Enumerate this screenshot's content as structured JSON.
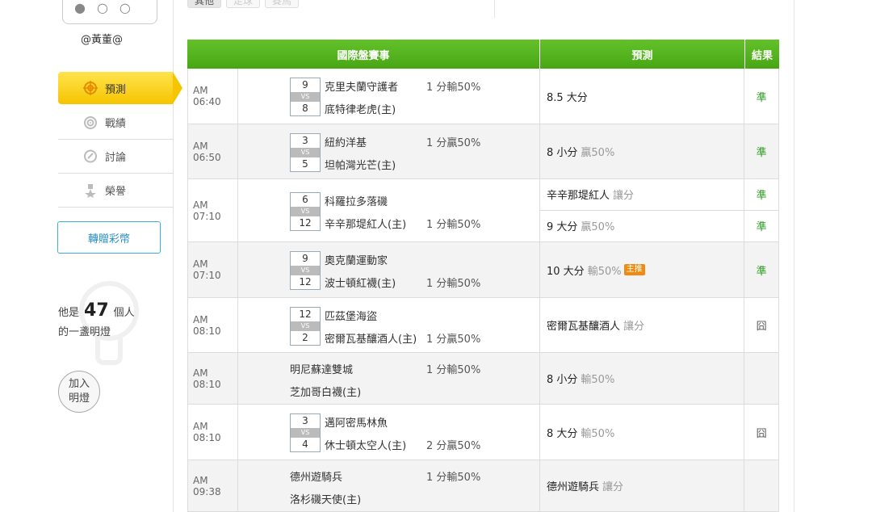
{
  "user": {
    "name": "@黃董@"
  },
  "menu": [
    {
      "label": "預測",
      "icon": "target-icon",
      "active": true
    },
    {
      "label": "戰績",
      "icon": "record-icon",
      "active": false
    },
    {
      "label": "討論",
      "icon": "chat-icon",
      "active": false
    },
    {
      "label": "榮譽",
      "icon": "medal-icon",
      "active": false
    }
  ],
  "gift_button": "轉贈彩幣",
  "bulb": {
    "prefix": "他是",
    "count": "47",
    "suffix": "個人",
    "line2": "的一盞明燈"
  },
  "join_button": {
    "line1": "加入",
    "line2": "明燈"
  },
  "top_tabs": [
    "其他",
    "足球",
    "賽馬"
  ],
  "table": {
    "headers": {
      "game": "國際盤賽事",
      "pred": "預測",
      "result": "結果"
    },
    "rows": [
      {
        "time": "AM 06:40",
        "rank1": "9",
        "rank2": "8",
        "vs": "VS",
        "team1": "克里夫蘭守護者",
        "team2": "底特律老虎(主)",
        "spread": "1 分輸50%",
        "spread_line": 1,
        "preds": [
          {
            "main": "8.5 大分",
            "sub": "",
            "badge": "",
            "result": "準"
          }
        ]
      },
      {
        "time": "AM 06:50",
        "rank1": "3",
        "rank2": "5",
        "vs": "VS",
        "team1": "紐約洋基",
        "team2": "坦帕灣光芒(主)",
        "spread": "1 分贏50%",
        "spread_line": 1,
        "preds": [
          {
            "main": "8 小分",
            "sub": "贏50%",
            "badge": "",
            "result": "準"
          }
        ]
      },
      {
        "time": "AM 07:10",
        "rank1": "6",
        "rank2": "12",
        "vs": "VS",
        "team1": "科羅拉多落磯",
        "team2": "辛辛那堤紅人(主)",
        "spread": "1 分輸50%",
        "spread_line": 2,
        "preds": [
          {
            "main": "辛辛那堤紅人",
            "sub": "讓分",
            "badge": "",
            "result": "準"
          },
          {
            "main": "9 大分",
            "sub": "贏50%",
            "badge": "",
            "result": "準"
          }
        ]
      },
      {
        "time": "AM 07:10",
        "rank1": "9",
        "rank2": "12",
        "vs": "VS",
        "team1": "奧克蘭運動家",
        "team2": "波士頓紅襪(主)",
        "spread": "1 分輸50%",
        "spread_line": 2,
        "preds": [
          {
            "main": "10 大分",
            "sub": "輸50%",
            "badge": "主推",
            "result": "準"
          }
        ]
      },
      {
        "time": "AM 08:10",
        "rank1": "12",
        "rank2": "2",
        "vs": "VS",
        "team1": "匹茲堡海盜",
        "team2": "密爾瓦基釀酒人(主)",
        "spread": "1 分贏50%",
        "spread_line": 2,
        "preds": [
          {
            "main": "密爾瓦基釀酒人",
            "sub": "讓分",
            "badge": "",
            "result": "囧"
          }
        ]
      },
      {
        "time": "AM 08:10",
        "rank1": "",
        "rank2": "",
        "vs": "",
        "team1": "明尼蘇達雙城",
        "team2": "芝加哥白襪(主)",
        "spread": "1 分輸50%",
        "spread_line": 1,
        "preds": [
          {
            "main": "8 小分",
            "sub": "輸50%",
            "badge": "",
            "result": ""
          }
        ]
      },
      {
        "time": "AM 08:10",
        "rank1": "3",
        "rank2": "4",
        "vs": "VS",
        "team1": "邁阿密馬林魚",
        "team2": "休士頓太空人(主)",
        "spread": "2 分贏50%",
        "spread_line": 2,
        "preds": [
          {
            "main": "8 大分",
            "sub": "輸50%",
            "badge": "",
            "result": "囧"
          }
        ]
      },
      {
        "time": "AM 09:38",
        "rank1": "",
        "rank2": "",
        "vs": "",
        "team1": "德州遊騎兵",
        "team2": "洛杉磯天使(主)",
        "spread": "1 分輸50%",
        "spread_line": 1,
        "preds": [
          {
            "main": "德州遊騎兵",
            "sub": "讓分",
            "badge": "",
            "result": ""
          }
        ]
      }
    ]
  }
}
